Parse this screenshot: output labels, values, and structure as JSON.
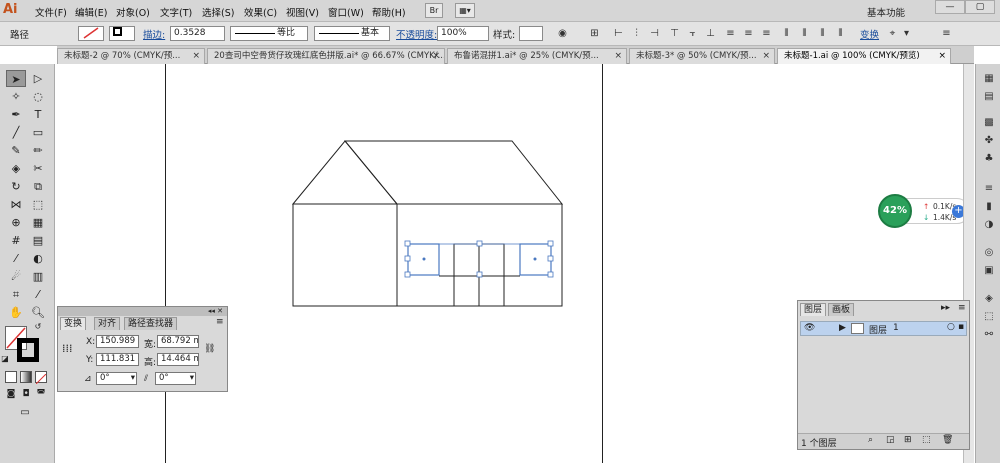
{
  "app": {
    "logo": "Ai",
    "workspace": "基本功能",
    "win_min": "—",
    "win_max": "▢"
  },
  "menu": [
    "文件(F)",
    "编辑(E)",
    "对象(O)",
    "文字(T)",
    "选择(S)",
    "效果(C)",
    "视图(V)",
    "窗口(W)",
    "帮助(H)"
  ],
  "menu_btns": [
    "Br",
    "▦▾"
  ],
  "control": {
    "object_type": "路径",
    "stroke_label": "描边:",
    "stroke_value": "0.3528",
    "profile_label": "等比",
    "brush_label": "基本",
    "opacity_label": "不透明度:",
    "opacity_value": "100%",
    "style_label": "样式:",
    "transform_label": "变换"
  },
  "tabs": [
    {
      "label": "未标题-2 @ 70% (CMYK/预...",
      "close": "×"
    },
    {
      "label": "20查司中空骨货仔玫瑰红底色拼版.ai* @ 66.67% (CMYK/...",
      "close": "×"
    },
    {
      "label": "布鲁诺混拼1.ai* @ 25% (CMYK/预...",
      "close": "×"
    },
    {
      "label": "未标题-3* @ 50% (CMYK/预...",
      "close": "×"
    },
    {
      "label": "未标题-1.ai @ 100% (CMYK/预览)",
      "close": "×"
    }
  ],
  "transform_panel": {
    "tabs": [
      "变换",
      "对齐",
      "路径查找器"
    ],
    "x_label": "X:",
    "x_value": "150.989",
    "w_label": "宽:",
    "w_value": "68.792 m",
    "y_label": "Y:",
    "y_value": "111.831",
    "h_label": "高:",
    "h_value": "14.464 m",
    "angle_value": "0°",
    "shear_value": "0°"
  },
  "speed_widget": {
    "percent": "42%",
    "up": "0.1K/s",
    "down": "1.4K/s"
  },
  "layers_panel": {
    "tabs": [
      "图层",
      "画板"
    ],
    "layer_name": "图层",
    "layer_index": "1",
    "footer": "1 个图层"
  }
}
